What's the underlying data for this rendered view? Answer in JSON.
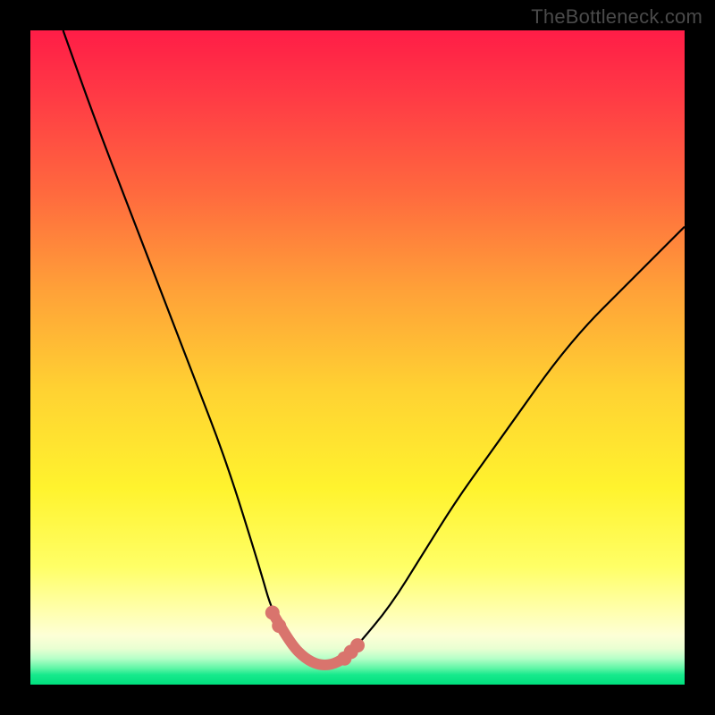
{
  "watermark": "TheBottleneck.com",
  "colors": {
    "background": "#000000",
    "curve_black": "#000000",
    "highlight_stroke": "#d9746d",
    "highlight_dot": "#d9746d"
  },
  "chart_data": {
    "type": "line",
    "title": "",
    "xlabel": "",
    "ylabel": "",
    "xlim": [
      0,
      100
    ],
    "ylim": [
      0,
      100
    ],
    "grid": false,
    "legend": false,
    "note": "Axes are unlabeled in the image. x and y are normalized 0–100 (% of plot width/height). y=0 at bottom, y=100 at top. Values estimated visually from the figure.",
    "series": [
      {
        "name": "bottleneck-curve",
        "x": [
          5,
          10,
          15,
          20,
          25,
          30,
          35,
          37,
          40,
          42,
          44,
          46,
          48,
          50,
          55,
          60,
          65,
          70,
          75,
          80,
          85,
          90,
          95,
          100
        ],
        "y": [
          100,
          86,
          73,
          60,
          47,
          34,
          18,
          11,
          6,
          4,
          3,
          3,
          4,
          6,
          12,
          20,
          28,
          35,
          42,
          49,
          55,
          60,
          65,
          70
        ]
      },
      {
        "name": "safe-zone-highlight",
        "x": [
          37,
          40,
          42,
          44,
          46,
          48,
          50
        ],
        "y": [
          11,
          6,
          4,
          3,
          3,
          4,
          6
        ]
      }
    ],
    "markers": [
      {
        "x": 37,
        "y": 11
      },
      {
        "x": 38,
        "y": 9
      },
      {
        "x": 48,
        "y": 4
      },
      {
        "x": 49,
        "y": 5
      },
      {
        "x": 50,
        "y": 6
      }
    ]
  }
}
